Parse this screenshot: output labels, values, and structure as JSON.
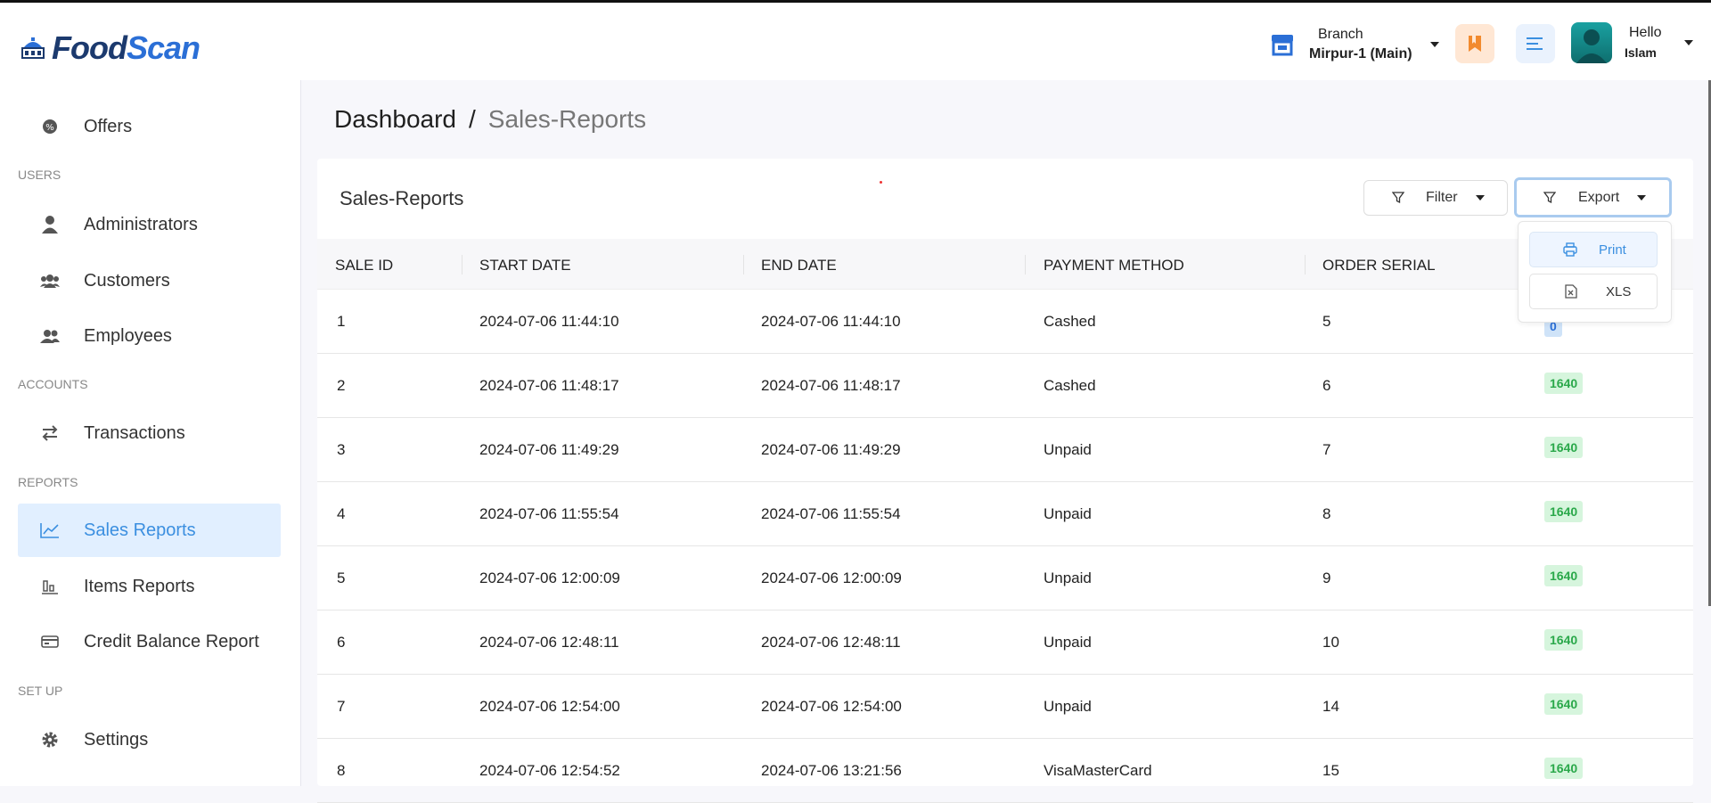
{
  "app": {
    "logo_part1": "Food",
    "logo_part2": "Scan"
  },
  "header": {
    "branch_label": "Branch",
    "branch_value": "Mirpur-1 (Main)",
    "greeting": "Hello",
    "user_name": "Islam"
  },
  "sidebar": {
    "items": [
      {
        "label": "Offers",
        "icon": "offers-icon"
      },
      {
        "section": "USERS"
      },
      {
        "label": "Administrators",
        "icon": "user-icon"
      },
      {
        "label": "Customers",
        "icon": "users-icon"
      },
      {
        "label": "Employees",
        "icon": "employees-icon"
      },
      {
        "section": "ACCOUNTS"
      },
      {
        "label": "Transactions",
        "icon": "transfer-icon"
      },
      {
        "section": "REPORTS"
      },
      {
        "label": "Sales Reports",
        "icon": "chart-line-icon",
        "active": true
      },
      {
        "label": "Items Reports",
        "icon": "bar-chart-icon"
      },
      {
        "label": "Credit Balance Report",
        "icon": "card-icon"
      },
      {
        "section": "SET UP"
      },
      {
        "label": "Settings",
        "icon": "gear-icon"
      }
    ]
  },
  "breadcrumb": {
    "root": "Dashboard",
    "separator": "/",
    "current": "Sales-Reports"
  },
  "card": {
    "title": "Sales-Reports",
    "filter_label": "Filter",
    "export_label": "Export"
  },
  "export_menu": {
    "print_label": "Print",
    "xls_label": "XLS"
  },
  "table": {
    "headers": [
      "SALE ID",
      "START DATE",
      "END DATE",
      "PAYMENT METHOD",
      "ORDER SERIAL"
    ],
    "rows": [
      [
        "1",
        "2024-07-06 11:44:10",
        "2024-07-06 11:44:10",
        "Cashed",
        "5",
        "0"
      ],
      [
        "2",
        "2024-07-06 11:48:17",
        "2024-07-06 11:48:17",
        "Cashed",
        "6",
        "1640"
      ],
      [
        "3",
        "2024-07-06 11:49:29",
        "2024-07-06 11:49:29",
        "Unpaid",
        "7",
        "1640"
      ],
      [
        "4",
        "2024-07-06 11:55:54",
        "2024-07-06 11:55:54",
        "Unpaid",
        "8",
        "1640"
      ],
      [
        "5",
        "2024-07-06 12:00:09",
        "2024-07-06 12:00:09",
        "Unpaid",
        "9",
        "1640"
      ],
      [
        "6",
        "2024-07-06 12:48:11",
        "2024-07-06 12:48:11",
        "Unpaid",
        "10",
        "1640"
      ],
      [
        "7",
        "2024-07-06 12:54:00",
        "2024-07-06 12:54:00",
        "Unpaid",
        "14",
        "1640"
      ],
      [
        "8",
        "2024-07-06 12:54:52",
        "2024-07-06 13:21:56",
        "VisaMasterCard",
        "15",
        "1640"
      ]
    ]
  },
  "colors": {
    "accent": "#3b8fe0",
    "badge_bg": "#d6f5dd",
    "badge_text": "#2aa84a",
    "brand_dark": "#1c3a6e"
  }
}
